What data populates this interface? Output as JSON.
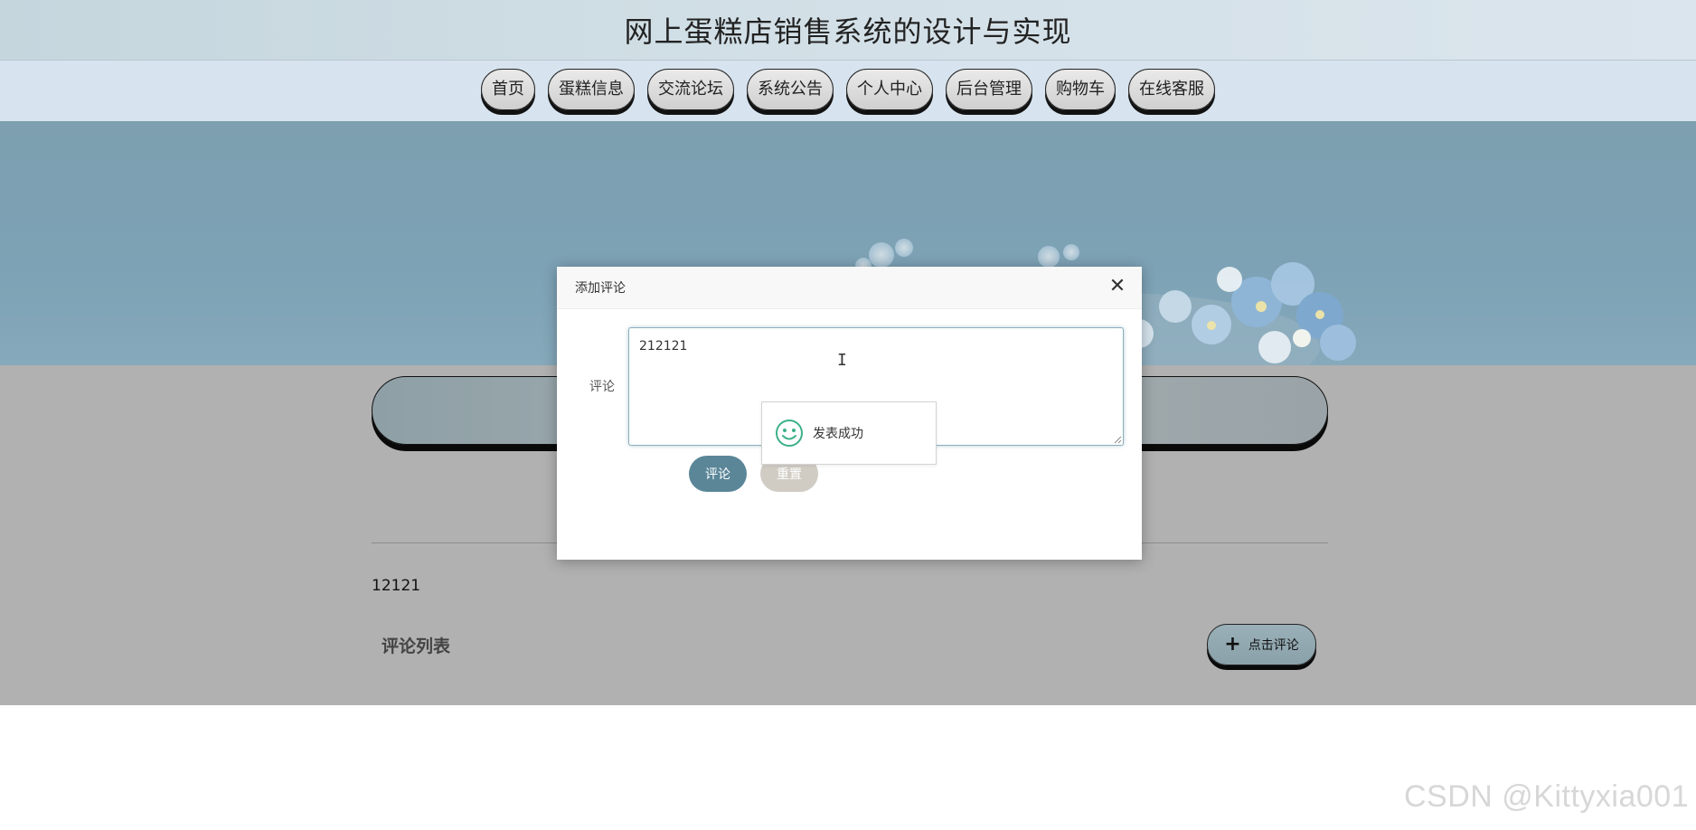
{
  "header": {
    "title": "网上蛋糕店销售系统的设计与实现"
  },
  "nav": {
    "items": [
      {
        "label": "首页"
      },
      {
        "label": "蛋糕信息"
      },
      {
        "label": "交流论坛"
      },
      {
        "label": "系统公告"
      },
      {
        "label": "个人中心"
      },
      {
        "label": "后台管理"
      },
      {
        "label": "购物车"
      },
      {
        "label": "在线客服"
      }
    ]
  },
  "main": {
    "post_content": "12121",
    "comment_list_title": "评论列表",
    "add_comment_button": "点击评论"
  },
  "modal": {
    "title": "添加评论",
    "close_icon": "close-icon",
    "field_label": "评论",
    "textarea_value": "212121",
    "submit_label": "评论",
    "reset_label": "重置"
  },
  "toast": {
    "icon": "smile-icon",
    "message": "发表成功"
  },
  "watermark": "CSDN @Kittyxia001",
  "colors": {
    "accent": "#5a8698",
    "reset": "#d0ccc4",
    "toast_icon": "#3cb08a"
  }
}
